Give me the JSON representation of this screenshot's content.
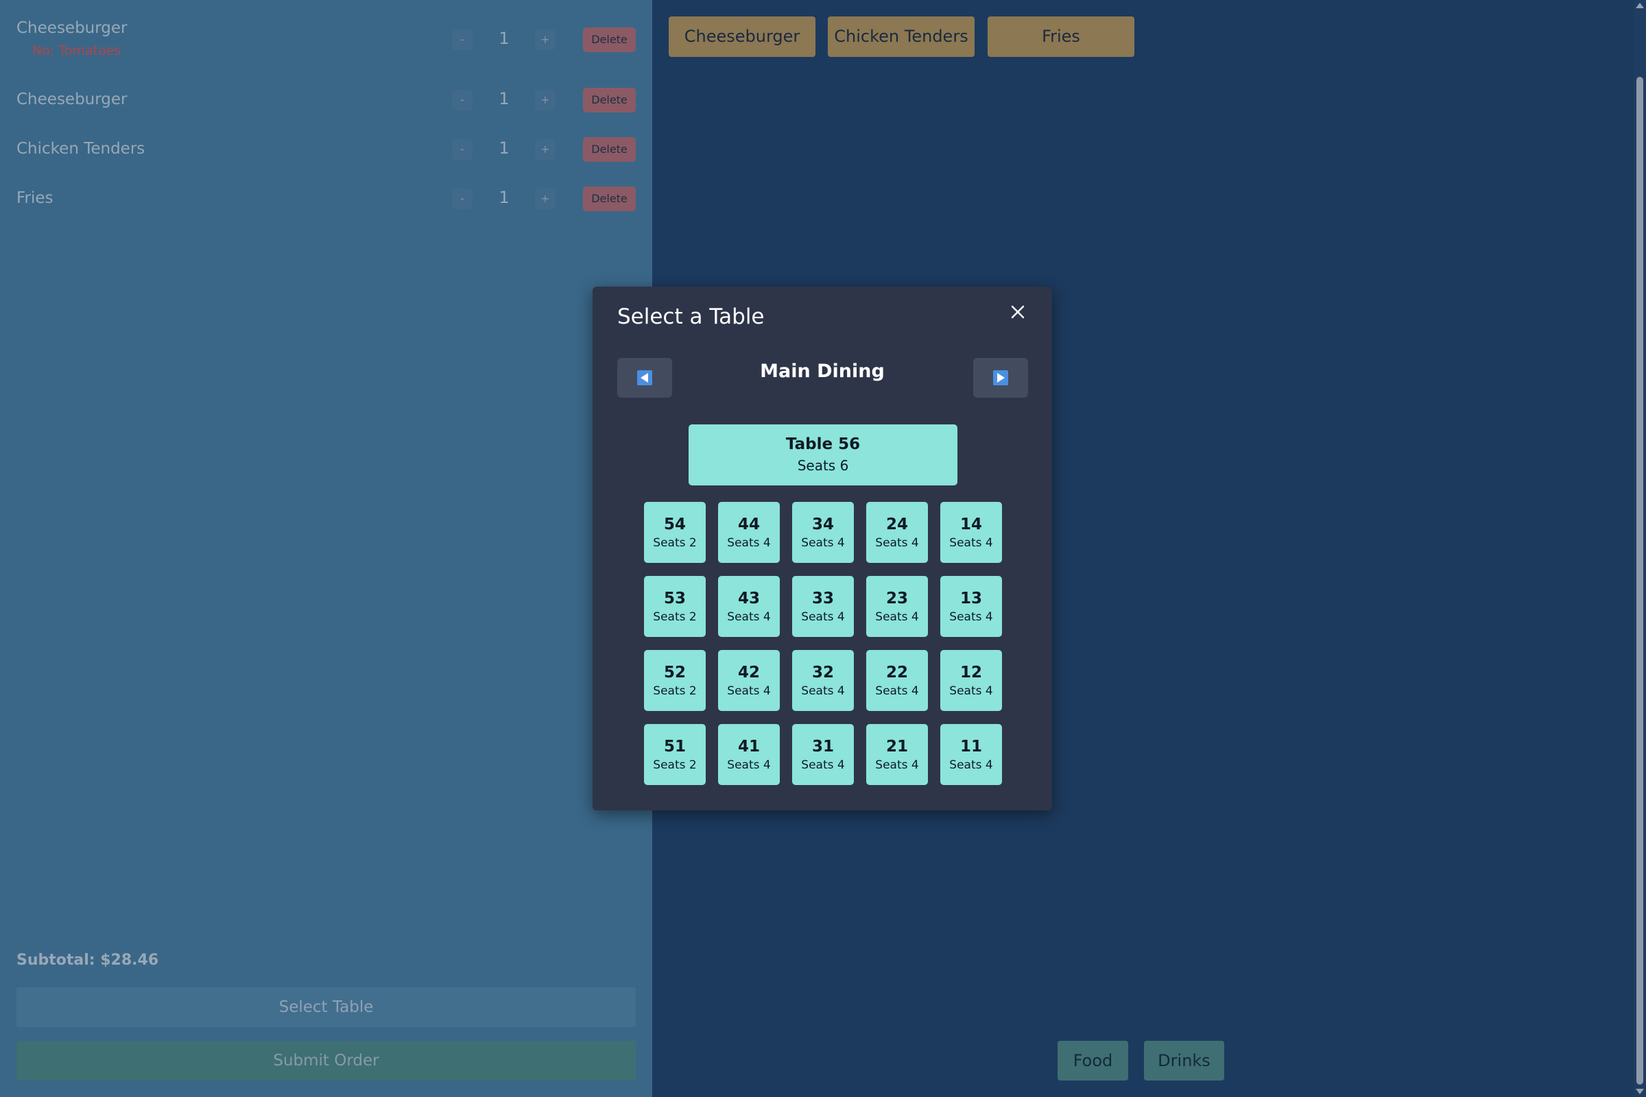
{
  "order": {
    "items": [
      {
        "name": "Cheeseburger",
        "modifier": "No: Tomatoes",
        "qty": "1"
      },
      {
        "name": "Cheeseburger",
        "modifier": "",
        "qty": "1"
      },
      {
        "name": "Chicken Tenders",
        "modifier": "",
        "qty": "1"
      },
      {
        "name": "Fries",
        "modifier": "",
        "qty": "1"
      }
    ],
    "minus_label": "-",
    "plus_label": "+",
    "delete_label": "Delete",
    "subtotal_label": "Subtotal: ",
    "subtotal_value": "$28.46",
    "select_table_label": "Select Table",
    "submit_order_label": "Submit Order"
  },
  "menu": {
    "items": [
      "Cheeseburger",
      "Chicken Tenders",
      "Fries"
    ],
    "categories": [
      "Food",
      "Drinks"
    ]
  },
  "modal": {
    "title": "Select a Table",
    "section": "Main Dining",
    "featured_table": {
      "label": "Table 56",
      "seats": "Seats 6"
    },
    "tables": [
      [
        {
          "num": "54",
          "seats": "Seats 2"
        },
        {
          "num": "44",
          "seats": "Seats 4"
        },
        {
          "num": "34",
          "seats": "Seats 4"
        },
        {
          "num": "24",
          "seats": "Seats 4"
        },
        {
          "num": "14",
          "seats": "Seats 4"
        }
      ],
      [
        {
          "num": "53",
          "seats": "Seats 2"
        },
        {
          "num": "43",
          "seats": "Seats 4"
        },
        {
          "num": "33",
          "seats": "Seats 4"
        },
        {
          "num": "23",
          "seats": "Seats 4"
        },
        {
          "num": "13",
          "seats": "Seats 4"
        }
      ],
      [
        {
          "num": "52",
          "seats": "Seats 2"
        },
        {
          "num": "42",
          "seats": "Seats 4"
        },
        {
          "num": "32",
          "seats": "Seats 4"
        },
        {
          "num": "22",
          "seats": "Seats 4"
        },
        {
          "num": "12",
          "seats": "Seats 4"
        }
      ],
      [
        {
          "num": "51",
          "seats": "Seats 2"
        },
        {
          "num": "41",
          "seats": "Seats 4"
        },
        {
          "num": "31",
          "seats": "Seats 4"
        },
        {
          "num": "21",
          "seats": "Seats 4"
        },
        {
          "num": "11",
          "seats": "Seats 4"
        }
      ]
    ],
    "icons": {
      "prev": "arrow-left-icon",
      "next": "arrow-right-icon",
      "close": "close-icon"
    }
  },
  "colors": {
    "order_panel_bg": "#3a6788",
    "app_bg": "#1c3a5e",
    "menu_button": "#8c7852",
    "delete_button": "#8c5a64",
    "category_button": "#3f6f72",
    "modal_bg": "#2e3548",
    "table_tile": "#8ce4da",
    "nav_arrow": "#4a90e2",
    "modifier_text": "#b0454a"
  }
}
